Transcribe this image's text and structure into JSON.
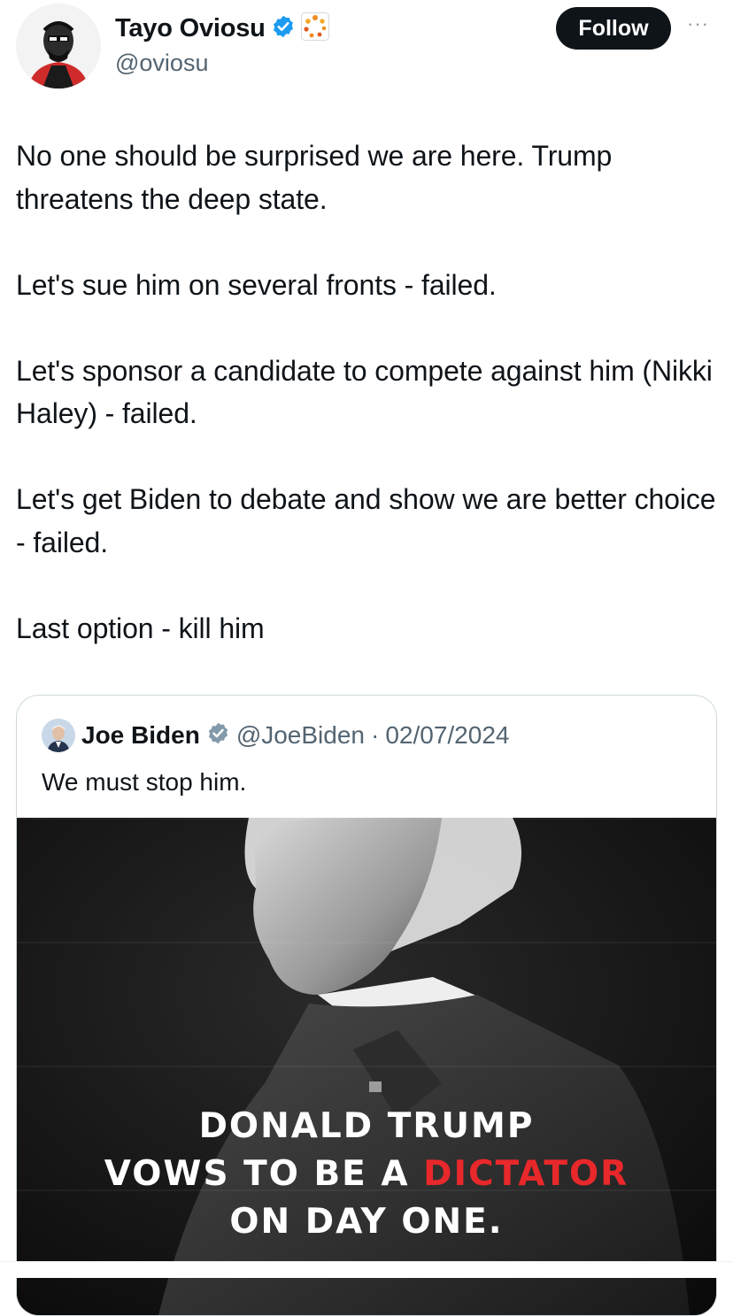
{
  "author": {
    "name": "Tayo Oviosu",
    "handle": "@oviosu",
    "verified": true,
    "badge_color": "#1d9bf0",
    "affiliate_badge": "orange-dots-logo"
  },
  "actions": {
    "follow_label": "Follow",
    "more_label": "···"
  },
  "tweet": {
    "text": "No one should be surprised we are here. Trump threatens the deep state.\n\nLet's sue him on several fronts - failed.\n\nLet's sponsor a candidate to compete against him (Nikki Haley) - failed.\n\nLet's get Biden to debate and show we are better choice - failed.\n\nLast option - kill him"
  },
  "quoted_tweet": {
    "name": "Joe Biden",
    "handle": "@JoeBiden",
    "separator": "·",
    "date": "02/07/2024",
    "verified_color": "#829aab",
    "text": "We must stop him.",
    "image": {
      "headline_line1": "DONALD TRUMP",
      "headline_line2_prefix": "VOWS TO BE A ",
      "headline_line2_red": "DICTATOR",
      "headline_line3": "ON DAY ONE.",
      "accent_color": "#e8282b"
    }
  }
}
